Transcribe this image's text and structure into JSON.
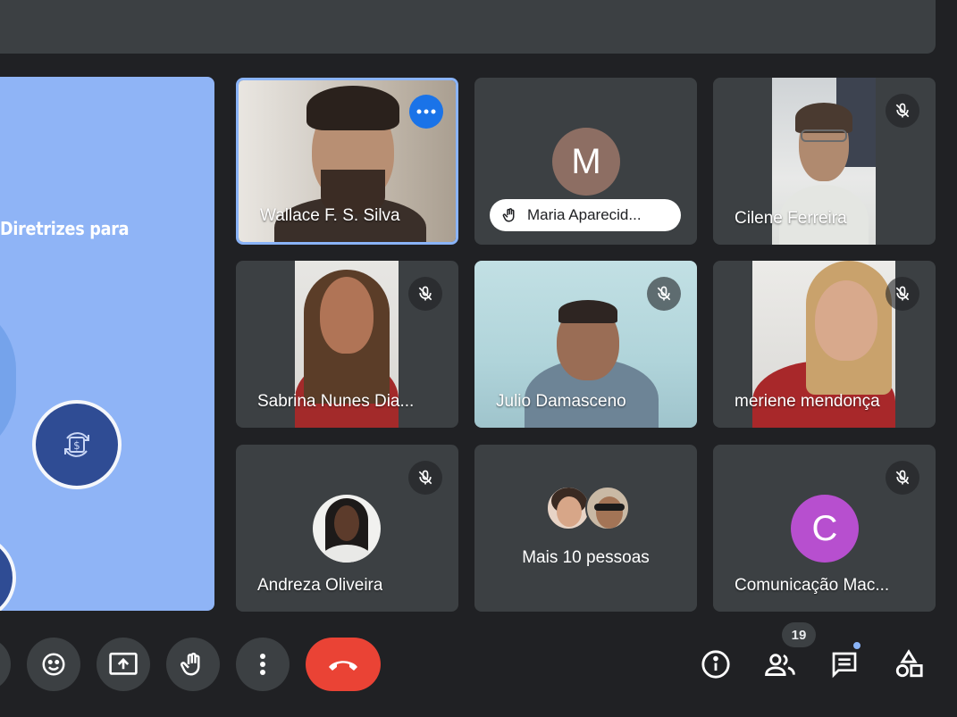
{
  "presentation": {
    "title": "Diretrizes para"
  },
  "participants": [
    {
      "name": "Wallace F. S. Silva"
    },
    {
      "name": "Maria Aparecid...",
      "initial": "M",
      "avatar_color": "#8d6e63",
      "status": "hand-raised"
    },
    {
      "name": "Cilene Ferreira"
    },
    {
      "name": "Sabrina Nunes Dia..."
    },
    {
      "name": "Julio Damasceno"
    },
    {
      "name": "meriene mendonça"
    },
    {
      "name": "Andreza Oliveira"
    },
    {
      "label": "Mais 10 pessoas"
    },
    {
      "name": "Comunicação Mac...",
      "initial": "C",
      "avatar_color": "#b74fcf"
    }
  ],
  "toolbar": {
    "participant_count": "19",
    "end_call_color": "#ea4335",
    "accent": "#8ab4f8"
  }
}
